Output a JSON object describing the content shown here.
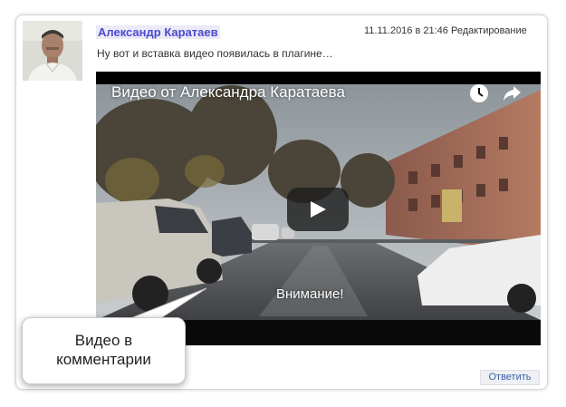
{
  "comment": {
    "author": "Александр Каратаев",
    "date": "11.11.2016 в 21:46",
    "edit_label": "Редактирование",
    "text": "Ну вот и вставка видео появилась в плагине…",
    "reply_label": "Ответить"
  },
  "avatar": {
    "icon": "user-avatar-photo"
  },
  "video": {
    "title": "Видео от Александра Каратаева",
    "caption": "Внимание!",
    "watch_later_icon": "clock-icon",
    "share_icon": "share-icon",
    "play_icon": "play-icon"
  },
  "callout": {
    "line1": "Видео в",
    "line2": "комментарии"
  },
  "colors": {
    "author": "#4a4ad0",
    "reply_text": "#3a5da8",
    "card_border": "#d6d6d6"
  }
}
